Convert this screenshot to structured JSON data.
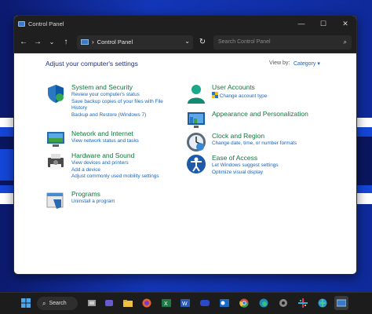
{
  "window": {
    "title": "Control Panel",
    "minimize_glyph": "—",
    "maximize_glyph": "☐",
    "close_glyph": "✕"
  },
  "navbar": {
    "back_glyph": "←",
    "forward_glyph": "→",
    "recent_glyph": "⌄",
    "up_glyph": "↑",
    "address_separator": "›",
    "address_text": "Control Panel",
    "address_dropdown_glyph": "⌄",
    "refresh_glyph": "↻",
    "search_placeholder": "Search Control Panel",
    "search_glyph": "⌕"
  },
  "content": {
    "heading": "Adjust your computer's settings",
    "view_by_label": "View by:",
    "view_by_value": "Category ▾",
    "categories_left": [
      {
        "title": "System and Security",
        "icon": "shield-icon",
        "links": [
          "Review your computer's status",
          "Save backup copies of your files with File History",
          "Backup and Restore (Windows 7)"
        ]
      },
      {
        "title": "Network and Internet",
        "icon": "network-icon",
        "links": [
          "View network status and tasks"
        ]
      },
      {
        "title": "Hardware and Sound",
        "icon": "printer-icon",
        "links": [
          "View devices and printers",
          "Add a device",
          "Adjust commonly used mobility settings"
        ]
      },
      {
        "title": "Programs",
        "icon": "programs-icon",
        "links": [
          "Uninstall a program"
        ]
      }
    ],
    "categories_right": [
      {
        "title": "User Accounts",
        "icon": "user-icon",
        "links": [
          "Change account type"
        ]
      },
      {
        "title": "Appearance and Personalization",
        "icon": "display-icon",
        "links": []
      },
      {
        "title": "Clock and Region",
        "icon": "clock-icon",
        "links": [
          "Change date, time, or number formats"
        ]
      },
      {
        "title": "Ease of Access",
        "icon": "accessibility-icon",
        "links": [
          "Let Windows suggest settings",
          "Optimize visual display"
        ]
      }
    ]
  },
  "taskbar": {
    "search_label": "Search",
    "search_glyph": "⌕",
    "apps": [
      "start-icon",
      "task-view-icon",
      "teams-icon",
      "file-explorer-icon",
      "firefox-icon",
      "excel-icon",
      "word-icon",
      "app-icon",
      "outlook-icon",
      "chrome-icon",
      "edge-icon",
      "gear-icon",
      "settings-icon",
      "slack-icon",
      "browser-icon",
      "control-panel-icon"
    ],
    "colors": {
      "accent": "#0a7a3a",
      "link": "#1565c0",
      "heading": "#1e3287"
    }
  }
}
